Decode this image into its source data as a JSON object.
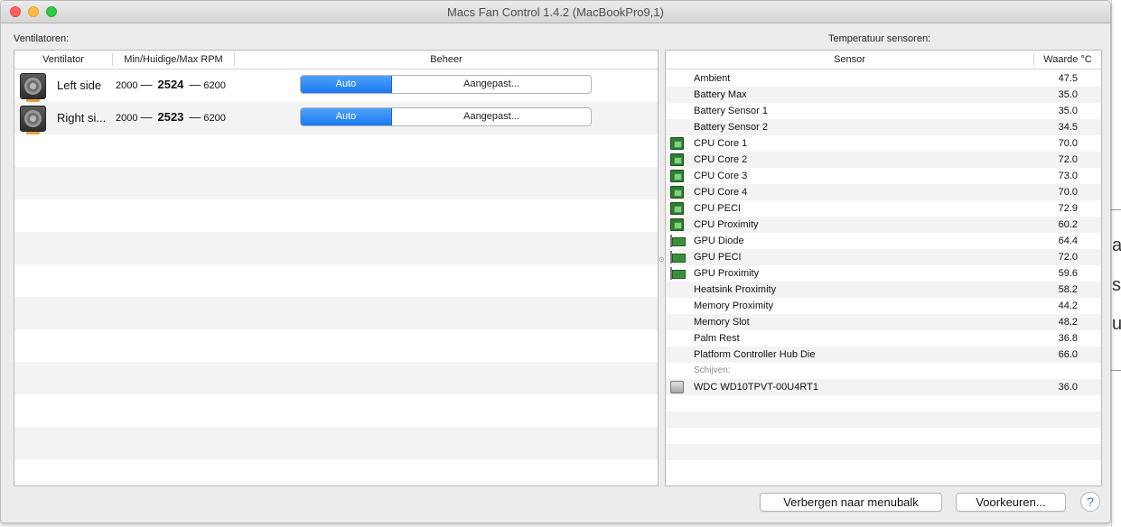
{
  "window": {
    "title": "Macs Fan Control 1.4.2 (MacBookPro9,1)"
  },
  "fans_section": {
    "label": "Ventilatoren:",
    "columns": {
      "fan": "Ventilator",
      "rpm": "Min/Huidige/Max RPM",
      "control": "Beheer"
    },
    "rows": [
      {
        "name": "Left side",
        "min": "2000",
        "current": "2524",
        "max": "6200",
        "auto_label": "Auto",
        "custom_label": "Aangepast..."
      },
      {
        "name": "Right si...",
        "min": "2000",
        "current": "2523",
        "max": "6200",
        "auto_label": "Auto",
        "custom_label": "Aangepast..."
      }
    ],
    "separator": "—"
  },
  "sensors_section": {
    "label": "Temperatuur sensoren:",
    "columns": {
      "sensor": "Sensor",
      "value": "Waarde °C"
    },
    "rows": [
      {
        "name": "Ambient",
        "value": "47.5",
        "icon": "none"
      },
      {
        "name": "Battery Max",
        "value": "35.0",
        "icon": "none"
      },
      {
        "name": "Battery Sensor 1",
        "value": "35.0",
        "icon": "none"
      },
      {
        "name": "Battery Sensor 2",
        "value": "34.5",
        "icon": "none"
      },
      {
        "name": "CPU Core 1",
        "value": "70.0",
        "icon": "cpu-chip-icon"
      },
      {
        "name": "CPU Core 2",
        "value": "72.0",
        "icon": "cpu-chip-icon"
      },
      {
        "name": "CPU Core 3",
        "value": "73.0",
        "icon": "cpu-chip-icon"
      },
      {
        "name": "CPU Core 4",
        "value": "70.0",
        "icon": "cpu-chip-icon"
      },
      {
        "name": "CPU PECI",
        "value": "72.9",
        "icon": "cpu-chip-icon"
      },
      {
        "name": "CPU Proximity",
        "value": "60.2",
        "icon": "cpu-chip-icon"
      },
      {
        "name": "GPU Diode",
        "value": "64.4",
        "icon": "gpu-card-icon"
      },
      {
        "name": "GPU PECI",
        "value": "72.0",
        "icon": "gpu-card-icon"
      },
      {
        "name": "GPU Proximity",
        "value": "59.6",
        "icon": "gpu-card-icon"
      },
      {
        "name": "Heatsink Proximity",
        "value": "58.2",
        "icon": "none"
      },
      {
        "name": "Memory Proximity",
        "value": "44.2",
        "icon": "none"
      },
      {
        "name": "Memory Slot",
        "value": "48.2",
        "icon": "none"
      },
      {
        "name": "Palm Rest",
        "value": "36.8",
        "icon": "none"
      },
      {
        "name": "Platform Controller Hub Die",
        "value": "66.0",
        "icon": "none"
      }
    ],
    "disks_group_label": "Schijven:",
    "disks": [
      {
        "name": "WDC WD10TPVT-00U4RT1",
        "value": "36.0",
        "icon": "hard-disk-icon"
      }
    ]
  },
  "footer": {
    "hide_button": "Verbergen naar menubalk",
    "prefs_button": "Voorkeuren...",
    "help_button": "?"
  },
  "background_window": {
    "letters": [
      "ar",
      "si",
      "u"
    ]
  }
}
